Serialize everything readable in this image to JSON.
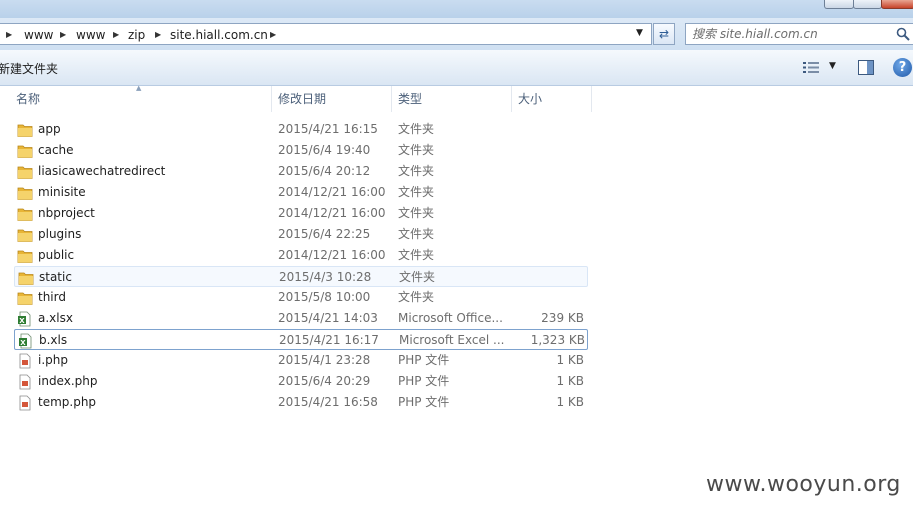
{
  "address": {
    "crumbs": [
      "www",
      "www",
      "zip",
      "site.hiall.com.cn"
    ]
  },
  "search": {
    "placeholder": "搜索 site.hiall.com.cn"
  },
  "toolbar": {
    "new_folder_label": "新建文件夹"
  },
  "columns": {
    "name": "名称",
    "date": "修改日期",
    "type": "类型",
    "size": "大小"
  },
  "files": [
    {
      "name": "app",
      "date": "2015/4/21 16:15",
      "type": "文件夹",
      "size": "",
      "icon": "folder-icon"
    },
    {
      "name": "cache",
      "date": "2015/6/4 19:40",
      "type": "文件夹",
      "size": "",
      "icon": "folder-icon"
    },
    {
      "name": "liasicawechatredirect",
      "date": "2015/6/4 20:12",
      "type": "文件夹",
      "size": "",
      "icon": "folder-icon"
    },
    {
      "name": "minisite",
      "date": "2014/12/21 16:00",
      "type": "文件夹",
      "size": "",
      "icon": "folder-icon"
    },
    {
      "name": "nbproject",
      "date": "2014/12/21 16:00",
      "type": "文件夹",
      "size": "",
      "icon": "folder-icon"
    },
    {
      "name": "plugins",
      "date": "2015/6/4 22:25",
      "type": "文件夹",
      "size": "",
      "icon": "folder-icon"
    },
    {
      "name": "public",
      "date": "2014/12/21 16:00",
      "type": "文件夹",
      "size": "",
      "icon": "folder-icon"
    },
    {
      "name": "static",
      "date": "2015/4/3 10:28",
      "type": "文件夹",
      "size": "",
      "icon": "folder-icon"
    },
    {
      "name": "third",
      "date": "2015/5/8 10:00",
      "type": "文件夹",
      "size": "",
      "icon": "folder-icon"
    },
    {
      "name": "a.xlsx",
      "date": "2015/4/21 14:03",
      "type": "Microsoft Office...",
      "size": "239 KB",
      "icon": "excel-file-icon"
    },
    {
      "name": "b.xls",
      "date": "2015/4/21 16:17",
      "type": "Microsoft Excel ...",
      "size": "1,323 KB",
      "icon": "excel-file-icon"
    },
    {
      "name": "i.php",
      "date": "2015/4/1 23:28",
      "type": "PHP 文件",
      "size": "1 KB",
      "icon": "php-file-icon"
    },
    {
      "name": "index.php",
      "date": "2015/6/4 20:29",
      "type": "PHP 文件",
      "size": "1 KB",
      "icon": "php-file-icon"
    },
    {
      "name": "temp.php",
      "date": "2015/4/21 16:58",
      "type": "PHP 文件",
      "size": "1 KB",
      "icon": "php-file-icon"
    }
  ],
  "watermark": "www.wooyun.org",
  "colors": {
    "folder": "#e8b536",
    "header_text": "#4c607a",
    "accent": "#7da2ce"
  }
}
